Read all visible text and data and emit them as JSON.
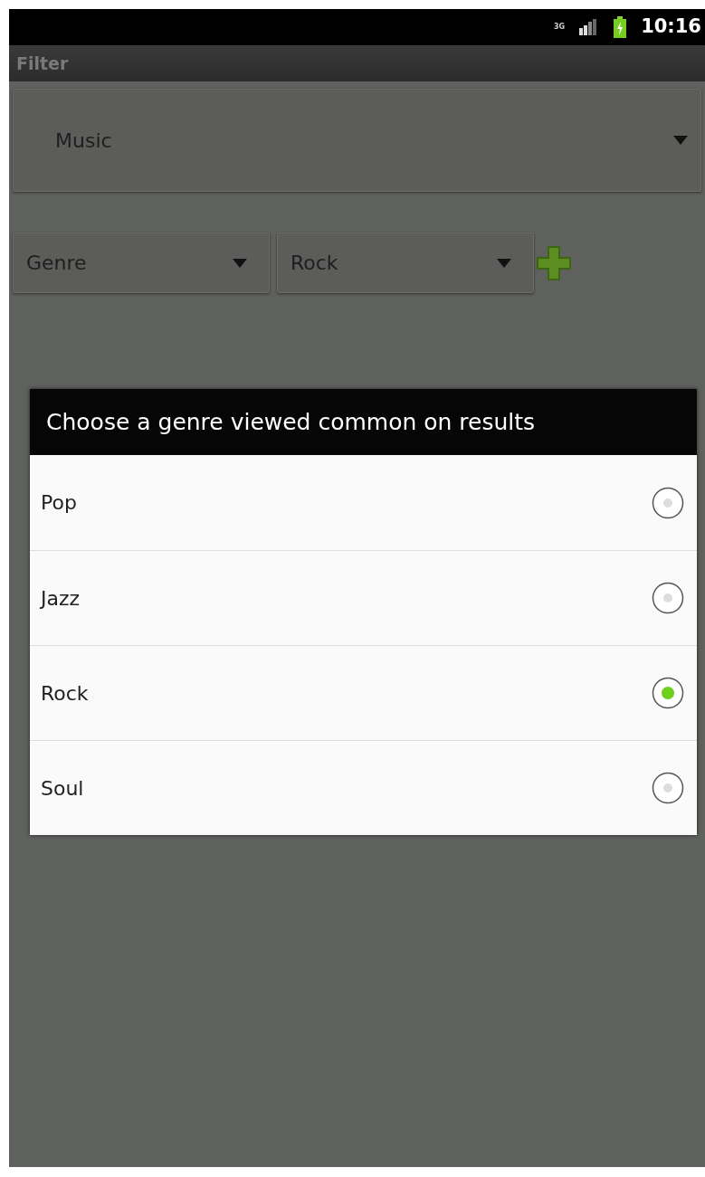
{
  "status_bar": {
    "network": "3G",
    "time": "10:16"
  },
  "title_bar": {
    "title": "Filter"
  },
  "category_spinner": {
    "value": "Music"
  },
  "filter_row": {
    "field_spinner": {
      "value": "Genre"
    },
    "value_spinner": {
      "value": "Rock"
    }
  },
  "dialog": {
    "title": "Choose a genre viewed common on results",
    "options": [
      {
        "label": "Pop",
        "selected": false
      },
      {
        "label": "Jazz",
        "selected": false
      },
      {
        "label": "Rock",
        "selected": true
      },
      {
        "label": "Soul",
        "selected": false
      }
    ]
  }
}
